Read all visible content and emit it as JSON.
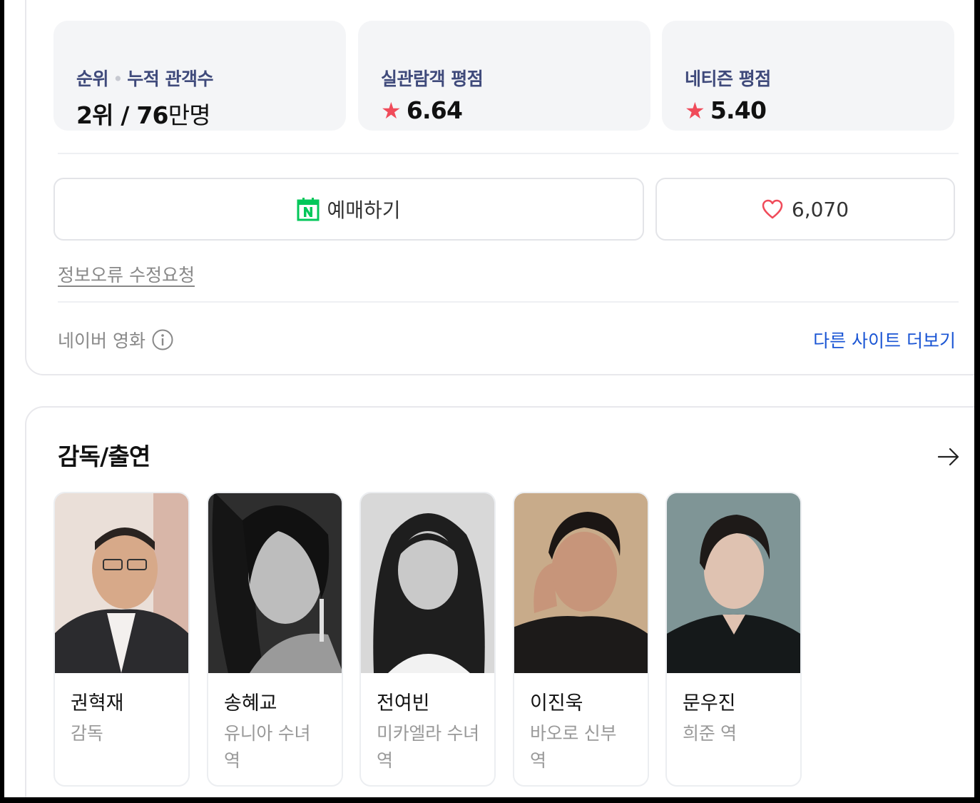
{
  "stats": [
    {
      "label_a": "순위",
      "sep": "•",
      "label_b": "누적 관객수",
      "value_main": "2위 / 76",
      "value_unit": "만명"
    },
    {
      "label": "실관람객 평점",
      "star": "★",
      "value": "6.64"
    },
    {
      "label": "네티즌 평점",
      "star": "★",
      "value": "5.40"
    }
  ],
  "buttons": {
    "booking_label": "예매하기",
    "booking_icon": "naver-calendar-icon",
    "like_count": "6,070",
    "like_icon": "heart-icon"
  },
  "report_link": "정보오류 수정요청",
  "footer": {
    "source": "네이버 영화",
    "more": "다른 사이트 더보기"
  },
  "cast_section": {
    "title": "감독/출연",
    "people": [
      {
        "name": "권혁재",
        "role": "감독"
      },
      {
        "name": "송혜교",
        "role": "유니아 수녀 역"
      },
      {
        "name": "전여빈",
        "role": "미카엘라 수녀 역"
      },
      {
        "name": "이진욱",
        "role": "바오로 신부 역"
      },
      {
        "name": "문우진",
        "role": "희준 역"
      }
    ]
  },
  "colors": {
    "label_navy": "#3f4a7b",
    "star_red": "#f04b5a",
    "link_blue": "#1a55d4",
    "naver_green": "#03c75a"
  }
}
